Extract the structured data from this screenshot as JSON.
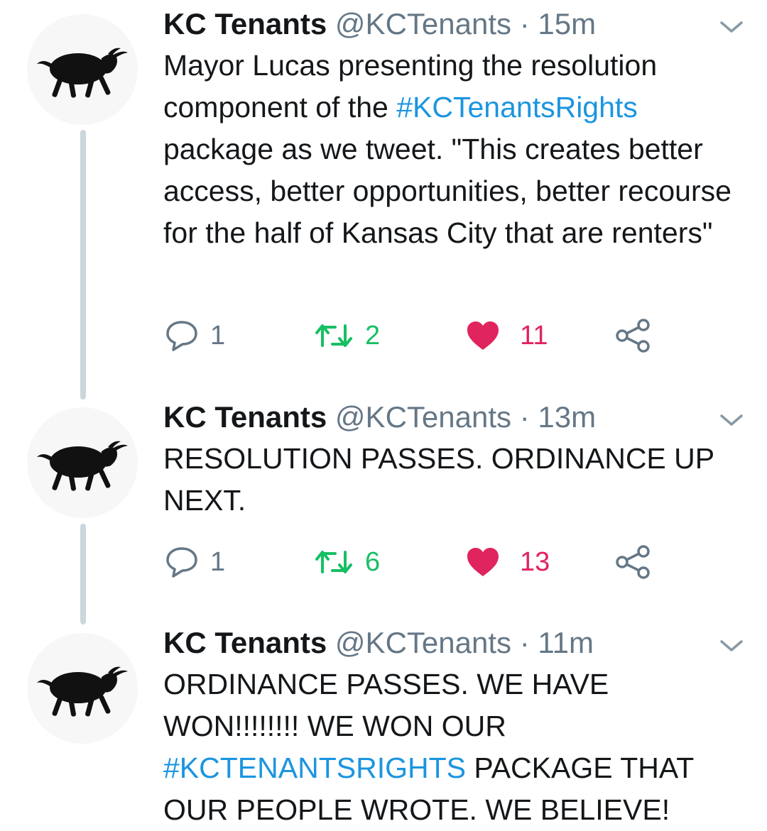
{
  "tweets": [
    {
      "author": {
        "name": "KC Tenants",
        "handle": "@KCTenants"
      },
      "separator": "·",
      "time": "15m",
      "text_parts": [
        {
          "text": "Mayor Lucas presenting the resolution component of the ",
          "type": "text"
        },
        {
          "text": "#KCTenantsRights",
          "type": "hashtag"
        },
        {
          "text": " package as we tweet. \"This creates better access, better opportunities, better recourse for the half of Kansas City that are renters\"",
          "type": "text"
        }
      ],
      "actions": {
        "reply_count": "1",
        "retweet_count": "2",
        "like_count": "11",
        "liked": true
      },
      "icons": {
        "reply": "reply-icon",
        "retweet": "retweet-icon",
        "like": "heart-icon",
        "share": "share-icon",
        "menu": "chevron-down-icon"
      }
    },
    {
      "author": {
        "name": "KC Tenants",
        "handle": "@KCTenants"
      },
      "separator": "·",
      "time": "13m",
      "text_parts": [
        {
          "text": "RESOLUTION PASSES. ORDINANCE UP NEXT.",
          "type": "text"
        }
      ],
      "actions": {
        "reply_count": "1",
        "retweet_count": "6",
        "like_count": "13",
        "liked": true
      },
      "icons": {
        "reply": "reply-icon",
        "retweet": "retweet-icon",
        "like": "heart-icon",
        "share": "share-icon",
        "menu": "chevron-down-icon"
      }
    },
    {
      "author": {
        "name": "KC Tenants",
        "handle": "@KCTenants"
      },
      "separator": "·",
      "time": "11m",
      "text_parts": [
        {
          "text": "ORDINANCE PASSES. WE HAVE WON!!!!!!!! WE WON OUR ",
          "type": "text"
        },
        {
          "text": "#KCTENANTSRIGHTS",
          "type": "hashtag"
        },
        {
          "text": " PACKAGE THAT OUR PEOPLE WROTE. WE BELIEVE!",
          "type": "text"
        }
      ],
      "actions": null,
      "icons": {
        "menu": "chevron-down-icon"
      }
    }
  ],
  "colors": {
    "name": "#14171a",
    "meta": "#657786",
    "hashtag": "#1b95e0",
    "retweet": "#17bf63",
    "like": "#e0245e",
    "thread_line": "#ccd6dd"
  }
}
